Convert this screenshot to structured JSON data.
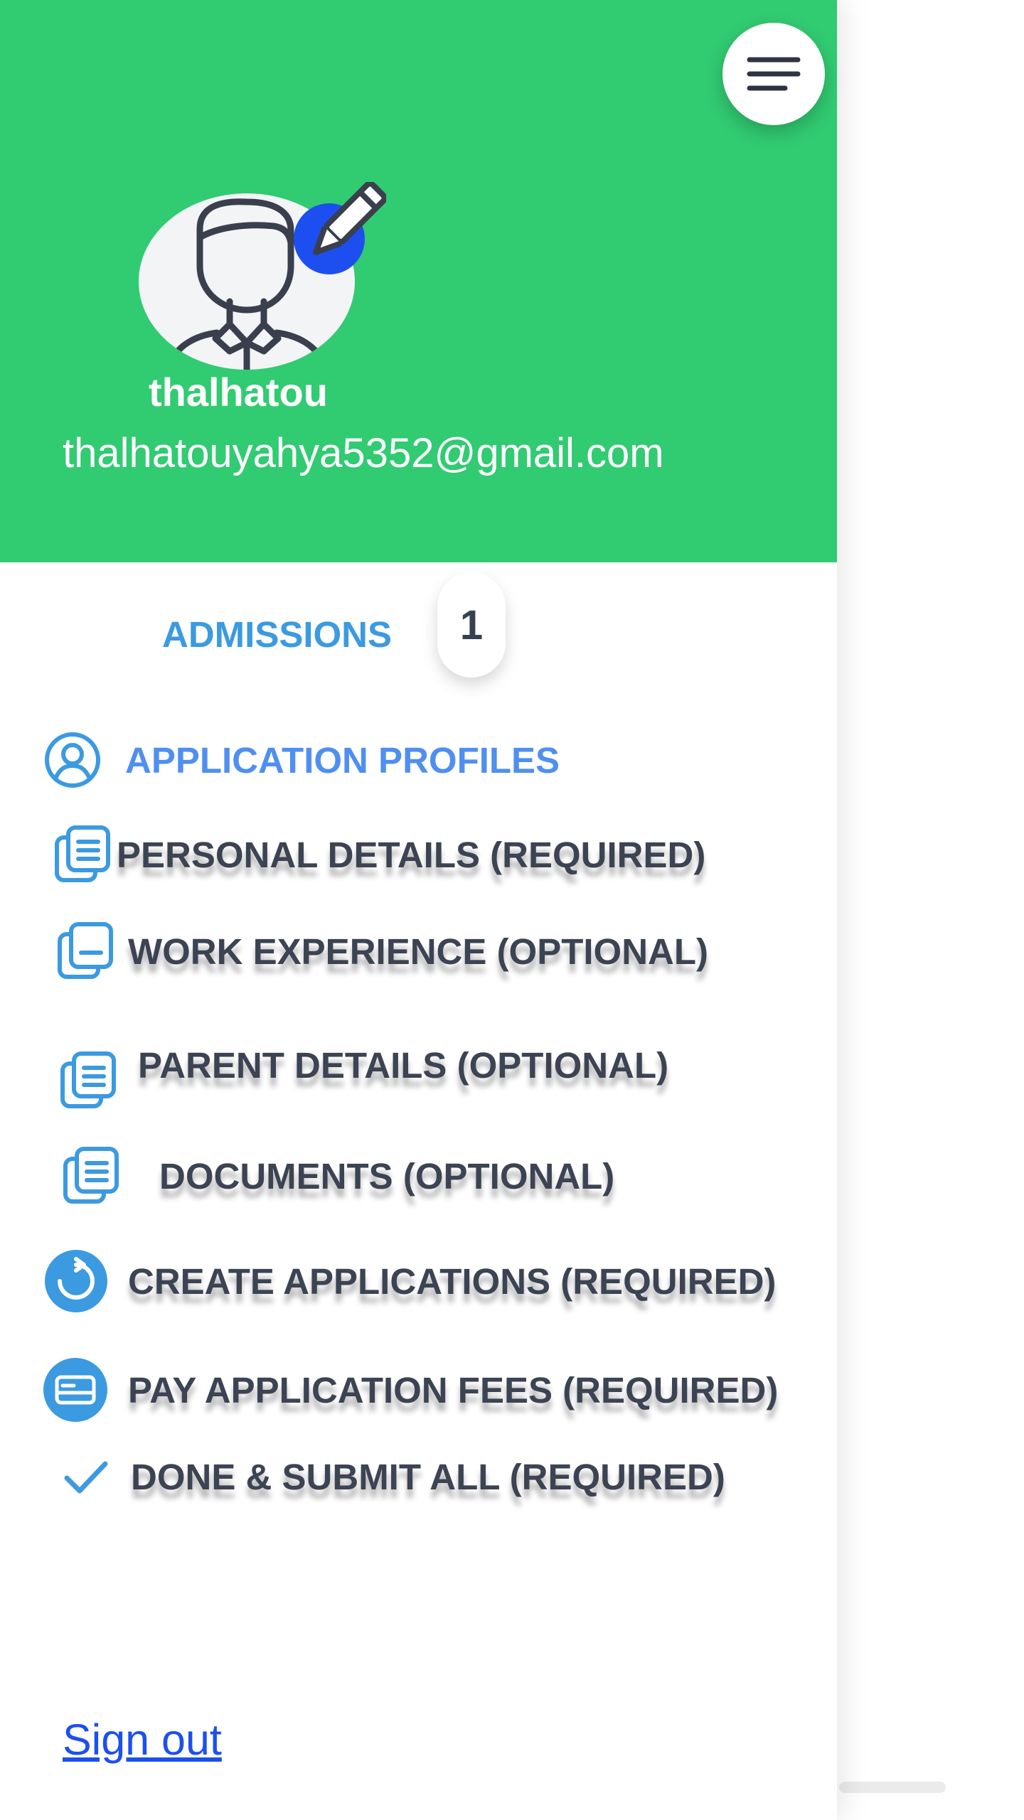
{
  "profile": {
    "username": "thalhatou",
    "email": "thalhatouyahya5352@gmail.com"
  },
  "tab": {
    "label": "ADMISSIONS",
    "count": "1"
  },
  "section": {
    "heading": "APPLICATION PROFILES"
  },
  "menu": {
    "items": [
      {
        "label": "PERSONAL DETAILS (REQUIRED)",
        "icon": "document-copy-icon"
      },
      {
        "label": "WORK EXPERIENCE (OPTIONAL)",
        "icon": "document-copy-icon"
      },
      {
        "label": "PARENT DETAILS (OPTIONAL)",
        "icon": "document-copy-icon"
      },
      {
        "label": "DOCUMENTS (OPTIONAL)",
        "icon": "document-copy-icon"
      },
      {
        "label": "CREATE APPLICATIONS (REQUIRED)",
        "icon": "refresh-circle-icon"
      },
      {
        "label": "PAY APPLICATION FEES (REQUIRED)",
        "icon": "credit-card-icon"
      },
      {
        "label": "DONE & SUBMIT ALL (REQUIRED)",
        "icon": "check-icon"
      }
    ]
  },
  "footer": {
    "signout_label": "Sign out"
  },
  "colors": {
    "header_green": "#31cb72",
    "accent_blue": "#3b9ae0",
    "heading_blue": "#4f8ff0",
    "link_blue": "#1c4ff0",
    "text_dark": "#3c4353"
  }
}
